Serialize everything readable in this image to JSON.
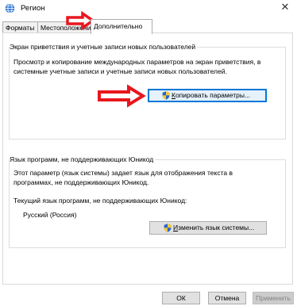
{
  "window": {
    "title": "Регион",
    "close_glyph": "✕"
  },
  "tabs": [
    {
      "label": "Форматы",
      "active": false
    },
    {
      "label": "Местоположение",
      "active": false
    },
    {
      "label": "Дополнительно",
      "active": true
    }
  ],
  "welcome_group": {
    "title": "Экран приветствия и учетные записи новых пользователей",
    "description_line1": "Просмотр и копирование международных параметров на экран приветствия, в",
    "description_line2": "системные учетные записи и учетные записи новых пользователей.",
    "copy_button": {
      "label_first": "К",
      "label_rest": "опировать параметры...",
      "icon": "uac-shield-icon"
    }
  },
  "language_group": {
    "title": "Язык программ, не поддерживающих Юникод",
    "description_line1": "Этот параметр (язык системы) задает язык для отображения текста в",
    "description_line2": "программах, не поддерживающих Юникод.",
    "current_label": "Текущий язык программ, не поддерживающих Юникод:",
    "current_value": "Русский (Россия)",
    "change_button": {
      "label_first": "И",
      "label_rest": "зменить язык системы...",
      "icon": "uac-shield-icon"
    }
  },
  "footer": {
    "ok_label": "ОК",
    "cancel_label": "Отмена",
    "apply_label": "Применить"
  },
  "colors": {
    "accent": "#0078d7",
    "arrow": "#e8171f",
    "title_icon": "#3a7bd5"
  }
}
